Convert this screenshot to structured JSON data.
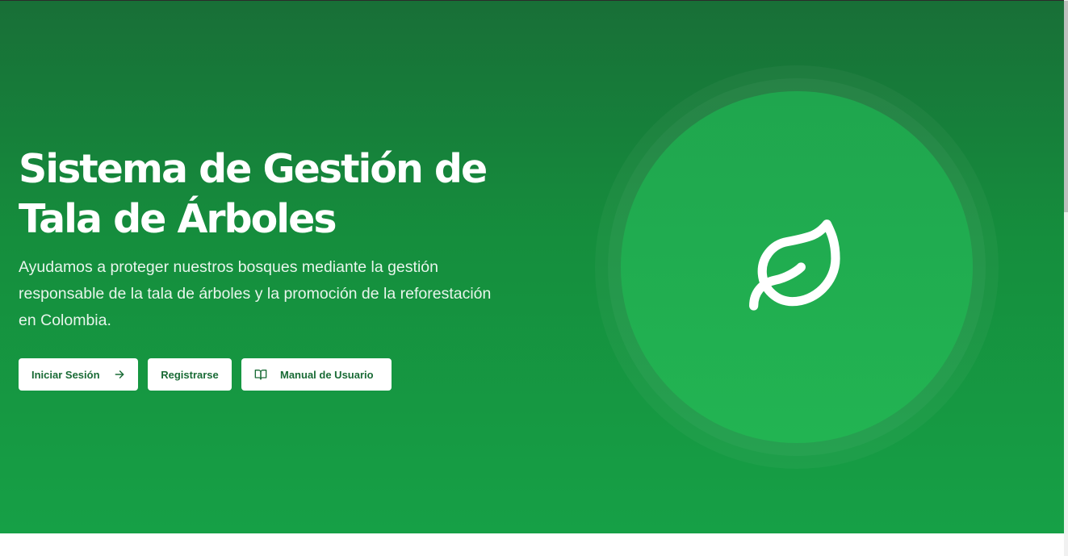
{
  "hero": {
    "title_line1": "Sistema de Gestión de",
    "title_line2": "Tala de Árboles",
    "subtitle": "Ayudamos a proteger nuestros bosques mediante la gestión responsable de la tala de árboles y la promoción de la reforestación en Colombia.",
    "icon": "leaf-icon"
  },
  "actions": {
    "login_label": "Iniciar Sesión",
    "login_icon": "arrow-right-icon",
    "register_label": "Registrarse",
    "manual_label": "Manual de Usuario",
    "manual_icon": "book-open-icon"
  },
  "colors": {
    "hero_top": "#186f37",
    "hero_bottom": "#16a046",
    "accent_text": "#1a6b36",
    "circle": "#22b452"
  }
}
